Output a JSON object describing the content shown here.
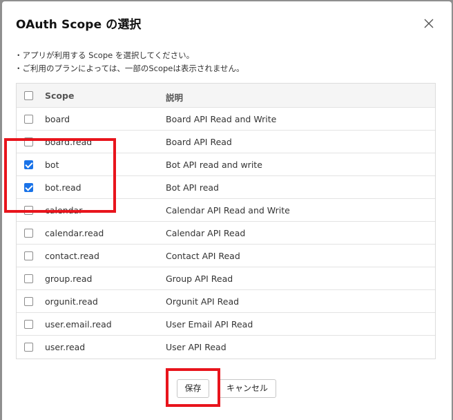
{
  "dialog": {
    "title": "OAuth Scope の選択",
    "close_icon": "close-x-icon",
    "notes": [
      "・アプリが利用する Scope を選択してください。",
      "・ご利用のプランによっては、一部のScopeは表示されません。"
    ]
  },
  "table": {
    "headers": {
      "scope": "Scope",
      "description": "説明"
    },
    "rows": [
      {
        "scope": "board",
        "description": "Board API Read and Write",
        "checked": false
      },
      {
        "scope": "board.read",
        "description": "Board API Read",
        "checked": false
      },
      {
        "scope": "bot",
        "description": "Bot API read and write",
        "checked": true
      },
      {
        "scope": "bot.read",
        "description": "Bot API read",
        "checked": true
      },
      {
        "scope": "calendar",
        "description": "Calendar API Read and Write",
        "checked": false
      },
      {
        "scope": "calendar.read",
        "description": "Calendar API Read",
        "checked": false
      },
      {
        "scope": "contact.read",
        "description": "Contact API Read",
        "checked": false
      },
      {
        "scope": "group.read",
        "description": "Group API Read",
        "checked": false
      },
      {
        "scope": "orgunit.read",
        "description": "Orgunit API Read",
        "checked": false
      },
      {
        "scope": "user.email.read",
        "description": "User Email API Read",
        "checked": false
      },
      {
        "scope": "user.read",
        "description": "User API Read",
        "checked": false
      }
    ]
  },
  "buttons": {
    "save": "保存",
    "cancel": "キャンセル"
  },
  "colors": {
    "checkbox_checked": "#1a73e8",
    "highlight": "#e8141c"
  }
}
